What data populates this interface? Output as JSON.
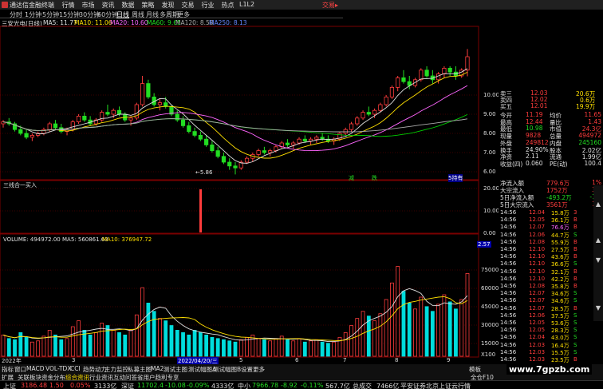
{
  "colors": {
    "up": "#ff3c3c",
    "down": "#22dd22",
    "ma5": "#e0e0e0",
    "ma10": "#ffe000",
    "ma20": "#ff66ff",
    "ma60": "#00cc00",
    "ma120": "#aaaaaa",
    "ma250": "#6688ff",
    "grid": "#7a0000"
  },
  "titlebar": {
    "app_title": "通达信金融终端",
    "menu": [
      "行情",
      "市场",
      "资讯",
      "数据",
      "策略",
      "发现",
      "交易",
      "行业",
      "热点"
    ],
    "level": "L1L2",
    "trade_label": "交易▸"
  },
  "periods": [
    "分时",
    "1分钟",
    "5分钟",
    "15分钟",
    "30分钟",
    "60分钟",
    "日线",
    "周线",
    "月线",
    "多周期",
    "更多"
  ],
  "ma_line": {
    "stock": "三安光电(日线)",
    "ma5": "MA5: 11.77",
    "ma10": "MA10: 11.06",
    "ma20": "MA20: 10.60",
    "ma60": "MA60: 9.65",
    "ma120": "MA120: 8.58",
    "ma250": "MA250: 8.13"
  },
  "price_axis": [
    "10.00",
    "9.00",
    "8.00",
    "7.00",
    "6.00"
  ],
  "low_marker": "←5.86",
  "buy_signals": [
    "减",
    "跌"
  ],
  "buy_signal_right": "5持有",
  "indicator": {
    "title": "三线合一买入",
    "axis": [
      "20.00",
      "10.00",
      "0.00"
    ],
    "value_box": "2.57"
  },
  "volume": {
    "title": "VOLUME: 494972.00",
    "ma5": "MA5: 560861.63",
    "ma10": "MA10: 376947.72",
    "axis": [
      "75000",
      "60000",
      "45000",
      "30000",
      "15000"
    ],
    "unit": "X100"
  },
  "dates": {
    "first": "2022年",
    "mid": "2022/04/20/三",
    "marks": [
      "3",
      "4",
      "5",
      "6",
      "7",
      "8",
      "9"
    ]
  },
  "quote": {
    "rows": [
      {
        "label": "卖三",
        "price": "12.03",
        "vol": "20.6万"
      },
      {
        "label": "卖四",
        "price": "12.02",
        "vol": "0.6万"
      },
      {
        "label": "买五",
        "price": "12.01",
        "vol": "19.9万"
      },
      {
        "label": "今开",
        "v1": "11.19",
        "l2": "均价",
        "v2": "11.65"
      },
      {
        "label": "最高",
        "v1": "12.44",
        "l2": "量比",
        "v2": "1.43"
      },
      {
        "label": "最低",
        "v1": "10.98",
        "l2": "市值",
        "v2": "24.3亿"
      },
      {
        "label": "现量",
        "v1": "9828",
        "l2": "总量",
        "v2": "494972"
      },
      {
        "label": "外盘",
        "v1": "249812",
        "l2": "内盘",
        "v2": "245160"
      },
      {
        "label": "换手",
        "v1": "24.90%",
        "l2": "股本",
        "v2": "2.02亿"
      },
      {
        "label": "净资",
        "v1": "2.11",
        "l2": "流通",
        "v2": "1.99亿"
      },
      {
        "label": "收益(四)",
        "v1": "0.060",
        "l2": "PE(动)",
        "v2": "100.4"
      }
    ],
    "flows": [
      {
        "label": "净流入额",
        "value": "779.6万",
        "pct": "1%"
      },
      {
        "label": "大宗流入",
        "value": "1752万",
        "pct": "3%"
      },
      {
        "label": "5日净流入额",
        "value": "-493.2万",
        "pct": "-1%"
      },
      {
        "label": "5日大宗流入",
        "value": "3561万",
        "pct": "1%"
      }
    ]
  },
  "ticks": [
    {
      "t": "14:56",
      "p": "12.04",
      "v": "15.8万",
      "d": "3",
      "c": "red"
    },
    {
      "t": "14:56",
      "p": "12.05",
      "v": "36.1万",
      "d": "B",
      "c": "red"
    },
    {
      "t": "14:56",
      "p": "12.07",
      "v": "76.6万",
      "d": "B",
      "c": "magenta"
    },
    {
      "t": "14:56",
      "p": "12.06",
      "v": "44.7万",
      "d": "S",
      "c": "green"
    },
    {
      "t": "14:56",
      "p": "12.08",
      "v": "55.9万",
      "d": "B",
      "c": "red"
    },
    {
      "t": "14:56",
      "p": "12.10",
      "v": "27.5万",
      "d": "B",
      "c": "red"
    },
    {
      "t": "14:56",
      "p": "12.10",
      "v": "43.6万",
      "d": "B",
      "c": "red"
    },
    {
      "t": "14:56",
      "p": "12.10",
      "v": "36.6万",
      "d": "S",
      "c": "green"
    },
    {
      "t": "14:56",
      "p": "12.10",
      "v": "32.1万",
      "d": "B",
      "c": "red"
    },
    {
      "t": "14:56",
      "p": "12.10",
      "v": "42.2万",
      "d": "B",
      "c": "red"
    },
    {
      "t": "14:56",
      "p": "12.08",
      "v": "35.8万",
      "d": "B",
      "c": "red"
    },
    {
      "t": "14:56",
      "p": "12.07",
      "v": "34.6万",
      "d": "S",
      "c": "green"
    },
    {
      "t": "14:56",
      "p": "12.07",
      "v": "34.6万",
      "d": "S",
      "c": "green"
    },
    {
      "t": "14:56",
      "p": "12.07",
      "v": "28.5万",
      "d": "B",
      "c": "red"
    },
    {
      "t": "14:56",
      "p": "12.06",
      "v": "37.5万",
      "d": "S",
      "c": "green"
    },
    {
      "t": "14:56",
      "p": "12.05",
      "v": "53.6万",
      "d": "S",
      "c": "green"
    },
    {
      "t": "14:56",
      "p": "12.05",
      "v": "28.3万",
      "d": "S",
      "c": "green"
    },
    {
      "t": "14:56",
      "p": "12.04",
      "v": "43.0万",
      "d": "S",
      "c": "green"
    },
    {
      "t": "14:56",
      "p": "12.03",
      "v": "16.4万",
      "d": "S",
      "c": "green"
    },
    {
      "t": "14:56",
      "p": "12.03",
      "v": "15.5万",
      "d": "S",
      "c": "green"
    },
    {
      "t": "14:56",
      "p": "12.03",
      "v": "23.5万",
      "d": "B",
      "c": "red"
    }
  ],
  "tabs1": [
    "指标",
    "窗口",
    "MACD",
    "VOL-TDX",
    "CCI",
    "趋势动力",
    "主力监控",
    "私募主图",
    "MA2",
    "测试主图",
    "测试幅图A",
    "测试幅图B",
    "设置",
    "更多"
  ],
  "tabs1_right": "模板",
  "tabs2": [
    "扩展",
    "关联板块",
    "资金分布",
    "综合资讯",
    "行业资讯",
    "互动问答",
    "省用户趋利专享"
  ],
  "tabs2_right": "全仓F10",
  "watermark": "www.7gpzb.com",
  "status": {
    "sh_label": "上证",
    "sh_val": "3186.48",
    "sh_ch": "1.50",
    "sh_pct": "0.05%",
    "sh_amt": "3133亿",
    "sz_label": "深证",
    "sz_val": "11702.4",
    "sz_ch": "-10.08",
    "sz_pct": "-0.09%",
    "sz_amt": "4333亿",
    "zx_label": "中小",
    "zx_val": "7966.78",
    "zx_ch": "-8.92",
    "zx_pct": "-0.11%",
    "zx_amt": "567.7亿",
    "total_label": "总成交",
    "total_val": "7466亿",
    "server": "平安证券北京上证云行情"
  },
  "chart_data": {
    "type": "candlestick",
    "title": "三安光电(日线)",
    "ylim": [
      5.5,
      11.5
    ],
    "ohlc": [
      [
        8.5,
        8.7,
        8.3,
        8.6
      ],
      [
        8.6,
        8.8,
        8.4,
        8.5
      ],
      [
        8.5,
        8.6,
        8.1,
        8.2
      ],
      [
        8.2,
        8.4,
        7.9,
        8.0
      ],
      [
        8.0,
        8.2,
        7.7,
        7.8
      ],
      [
        7.8,
        8.0,
        7.6,
        7.9
      ],
      [
        7.9,
        8.1,
        7.8,
        8.0
      ],
      [
        8.0,
        8.3,
        7.9,
        8.2
      ],
      [
        8.2,
        8.6,
        8.1,
        8.5
      ],
      [
        8.5,
        8.7,
        8.2,
        8.3
      ],
      [
        8.3,
        8.5,
        8.0,
        8.1
      ],
      [
        8.1,
        8.3,
        7.9,
        8.2
      ],
      [
        8.2,
        8.7,
        8.1,
        8.6
      ],
      [
        8.6,
        9.0,
        8.5,
        8.9
      ],
      [
        8.9,
        9.1,
        8.6,
        8.7
      ],
      [
        8.7,
        8.9,
        8.4,
        8.5
      ],
      [
        8.5,
        8.8,
        8.4,
        8.7
      ],
      [
        8.7,
        9.2,
        8.6,
        9.1
      ],
      [
        9.1,
        9.5,
        8.9,
        9.0
      ],
      [
        9.0,
        9.3,
        8.8,
        9.2
      ],
      [
        9.2,
        9.4,
        8.9,
        9.0
      ],
      [
        9.0,
        9.1,
        8.6,
        8.7
      ],
      [
        8.7,
        8.9,
        8.4,
        8.8
      ],
      [
        8.8,
        9.6,
        8.7,
        9.5
      ],
      [
        9.5,
        11.0,
        9.4,
        10.6
      ],
      [
        10.6,
        10.8,
        9.8,
        9.9
      ],
      [
        9.9,
        10.1,
        9.4,
        9.5
      ],
      [
        9.5,
        9.8,
        9.2,
        9.6
      ],
      [
        9.6,
        9.9,
        9.3,
        9.4
      ],
      [
        9.4,
        9.5,
        8.9,
        9.0
      ],
      [
        9.0,
        9.2,
        8.6,
        8.7
      ],
      [
        8.7,
        8.9,
        8.3,
        8.4
      ],
      [
        8.4,
        8.6,
        8.0,
        8.1
      ],
      [
        8.1,
        8.3,
        7.8,
        7.9
      ],
      [
        7.9,
        8.1,
        7.6,
        7.7
      ],
      [
        7.7,
        7.9,
        7.3,
        7.4
      ],
      [
        7.4,
        7.6,
        7.0,
        7.1
      ],
      [
        7.1,
        7.3,
        6.7,
        6.8
      ],
      [
        6.8,
        7.0,
        6.4,
        6.5
      ],
      [
        6.5,
        6.7,
        6.1,
        6.3
      ],
      [
        6.3,
        6.5,
        5.86,
        6.2
      ],
      [
        6.2,
        6.6,
        6.1,
        6.5
      ],
      [
        6.5,
        6.8,
        6.4,
        6.7
      ],
      [
        6.7,
        7.0,
        6.5,
        6.9
      ],
      [
        6.9,
        7.2,
        6.8,
        7.1
      ],
      [
        7.1,
        7.3,
        6.9,
        7.0
      ],
      [
        7.0,
        7.2,
        6.8,
        7.1
      ],
      [
        7.1,
        7.4,
        7.0,
        7.3
      ],
      [
        7.3,
        7.6,
        7.2,
        7.5
      ],
      [
        7.5,
        7.7,
        7.3,
        7.4
      ],
      [
        7.4,
        7.6,
        7.2,
        7.5
      ],
      [
        7.5,
        7.8,
        7.4,
        7.7
      ],
      [
        7.7,
        7.9,
        7.5,
        7.6
      ],
      [
        7.6,
        7.8,
        7.4,
        7.7
      ],
      [
        7.7,
        7.9,
        7.5,
        7.8
      ],
      [
        7.8,
        8.0,
        7.6,
        7.7
      ],
      [
        7.7,
        7.9,
        7.5,
        7.6
      ],
      [
        7.6,
        7.8,
        7.4,
        7.7
      ],
      [
        7.7,
        8.1,
        7.6,
        8.0
      ],
      [
        8.0,
        8.3,
        7.9,
        8.2
      ],
      [
        8.2,
        8.6,
        8.1,
        8.5
      ],
      [
        8.5,
        8.9,
        8.4,
        8.8
      ],
      [
        8.8,
        9.2,
        8.7,
        9.1
      ],
      [
        9.1,
        9.4,
        8.9,
        9.0
      ],
      [
        9.0,
        9.3,
        8.8,
        9.2
      ],
      [
        9.2,
        9.6,
        9.1,
        9.5
      ],
      [
        9.5,
        10.0,
        9.4,
        9.9
      ],
      [
        9.9,
        10.5,
        9.8,
        10.4
      ],
      [
        10.4,
        11.0,
        10.2,
        10.9
      ],
      [
        10.9,
        11.3,
        10.6,
        10.7
      ],
      [
        10.7,
        11.0,
        10.3,
        10.5
      ],
      [
        10.5,
        10.9,
        10.4,
        10.8
      ],
      [
        10.8,
        11.4,
        10.7,
        11.3
      ],
      [
        11.3,
        11.5,
        10.9,
        11.0
      ],
      [
        11.0,
        11.3,
        10.6,
        10.8
      ],
      [
        10.8,
        11.2,
        10.6,
        11.1
      ],
      [
        11.1,
        11.5,
        10.9,
        11.4
      ],
      [
        11.4,
        11.5,
        11.0,
        11.2
      ],
      [
        11.2,
        11.5,
        10.8,
        11.0
      ],
      [
        11.0,
        11.4,
        10.9,
        11.3
      ],
      [
        11.3,
        12.4,
        10.98,
        12.0
      ]
    ],
    "volume": [
      18,
      15,
      14,
      20,
      16,
      12,
      13,
      17,
      22,
      18,
      14,
      15,
      25,
      30,
      22,
      18,
      20,
      28,
      26,
      22,
      20,
      18,
      22,
      35,
      58,
      45,
      38,
      32,
      30,
      26,
      22,
      20,
      18,
      22,
      20,
      18,
      16,
      15,
      14,
      13,
      12,
      14,
      16,
      18,
      15,
      14,
      13,
      15,
      17,
      14,
      13,
      15,
      12,
      13,
      14,
      12,
      11,
      12,
      16,
      20,
      26,
      32,
      38,
      34,
      30,
      36,
      48,
      62,
      76,
      55,
      45,
      40,
      50,
      42,
      38,
      44,
      52,
      46,
      40,
      48,
      70
    ]
  }
}
